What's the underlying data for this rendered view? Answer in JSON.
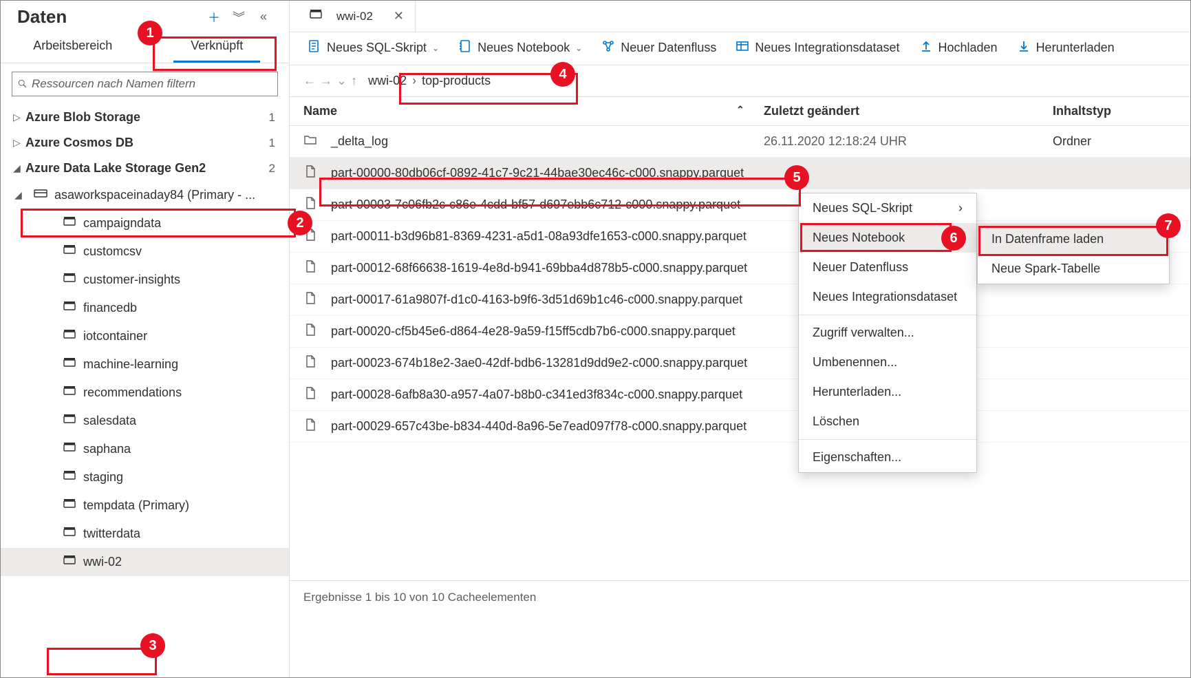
{
  "sidebar": {
    "title": "Daten",
    "tabs": {
      "workspace": "Arbeitsbereich",
      "linked": "Verknüpft"
    },
    "filterPlaceholder": "Ressourcen nach Namen filtern",
    "groups": [
      {
        "label": "Azure Blob Storage",
        "count": "1"
      },
      {
        "label": "Azure Cosmos DB",
        "count": "1"
      },
      {
        "label": "Azure Data Lake Storage Gen2",
        "count": "2"
      }
    ],
    "account": "asaworkspaceinaday84 (Primary - ...",
    "containers": [
      "campaigndata",
      "customcsv",
      "customer-insights",
      "financedb",
      "iotcontainer",
      "machine-learning",
      "recommendations",
      "salesdata",
      "saphana",
      "staging",
      "tempdata (Primary)",
      "twitterdata",
      "wwi-02"
    ]
  },
  "main": {
    "tabTitle": "wwi-02",
    "toolbar": {
      "sql": "Neues SQL-Skript",
      "notebook": "Neues Notebook",
      "dataflow": "Neuer Datenfluss",
      "dataset": "Neues Integrationsdataset",
      "upload": "Hochladen",
      "download": "Herunterladen"
    },
    "breadcrumb": [
      "wwi-02",
      "top-products"
    ],
    "columns": {
      "name": "Name",
      "modified": "Zuletzt geändert",
      "type": "Inhaltstyp"
    },
    "rows": [
      {
        "name": "_delta_log",
        "mod": "26.11.2020 12:18:24 UHR",
        "typ": "Ordner",
        "kind": "folder"
      },
      {
        "name": "part-00000-80db06cf-0892-41c7-9c21-44bae30ec46c-c000.snappy.parquet",
        "mod": "",
        "typ": "",
        "kind": "file"
      },
      {
        "name": "part-00003-7c06fb2c-c86e-4cdd-bf57-d697ebb6c712-c000.snappy.parquet",
        "mod": "",
        "typ": "",
        "kind": "file"
      },
      {
        "name": "part-00011-b3d96b81-8369-4231-a5d1-08a93dfe1653-c000.snappy.parquet",
        "mod": "",
        "typ": "",
        "kind": "file"
      },
      {
        "name": "part-00012-68f66638-1619-4e8d-b941-69bba4d878b5-c000.snappy.parquet",
        "mod": "",
        "typ": "",
        "kind": "file"
      },
      {
        "name": "part-00017-61a9807f-d1c0-4163-b9f6-3d51d69b1c46-c000.snappy.parquet",
        "mod": "",
        "typ": "",
        "kind": "file"
      },
      {
        "name": "part-00020-cf5b45e6-d864-4e28-9a59-f15ff5cdb7b6-c000.snappy.parquet",
        "mod": "",
        "typ": "",
        "kind": "file"
      },
      {
        "name": "part-00023-674b18e2-3ae0-42df-bdb6-13281d9dd9e2-c000.snappy.parquet",
        "mod": "",
        "typ": "",
        "kind": "file"
      },
      {
        "name": "part-00028-6afb8a30-a957-4a07-b8b0-c341ed3f834c-c000.snappy.parquet",
        "mod": "",
        "typ": "",
        "kind": "file"
      },
      {
        "name": "part-00029-657c43be-b834-440d-8a96-5e7ead097f78-c000.snappy.parquet",
        "mod": "",
        "typ": "",
        "kind": "file"
      }
    ],
    "footer": "Ergebnisse 1 bis 10 von 10 Cacheelementen"
  },
  "context1": [
    "Neues SQL-Skript",
    "Neues Notebook",
    "Neuer Datenfluss",
    "Neues Integrationsdataset",
    "---",
    "Zugriff verwalten...",
    "Umbenennen...",
    "Herunterladen...",
    "Löschen",
    "---",
    "Eigenschaften..."
  ],
  "context2": [
    "In Datenframe laden",
    "Neue Spark-Tabelle"
  ],
  "callouts": {
    "1": "1",
    "2": "2",
    "3": "3",
    "4": "4",
    "5": "5",
    "6": "6",
    "7": "7"
  }
}
